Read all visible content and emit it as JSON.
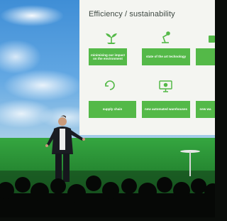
{
  "slide": {
    "title": "Efficiency / sustainability",
    "tiles": [
      {
        "label": "minimising our impact on the environment",
        "icon": "sprout-icon"
      },
      {
        "label": "state of the art technology",
        "icon": "robot-arm-icon"
      },
      {
        "label": "",
        "icon": "partial-icon"
      },
      {
        "label": "supply chain",
        "icon": "recycle-icon"
      },
      {
        "label": "new automated warehouses",
        "icon": "monitor-icon"
      },
      {
        "label": "new wa",
        "icon": ""
      }
    ]
  },
  "colors": {
    "tile_green": "#54b948",
    "stage_green": "#2f9a3c",
    "sky_blue": "#3d8fd8",
    "slide_bg": "#f4f5f1"
  }
}
